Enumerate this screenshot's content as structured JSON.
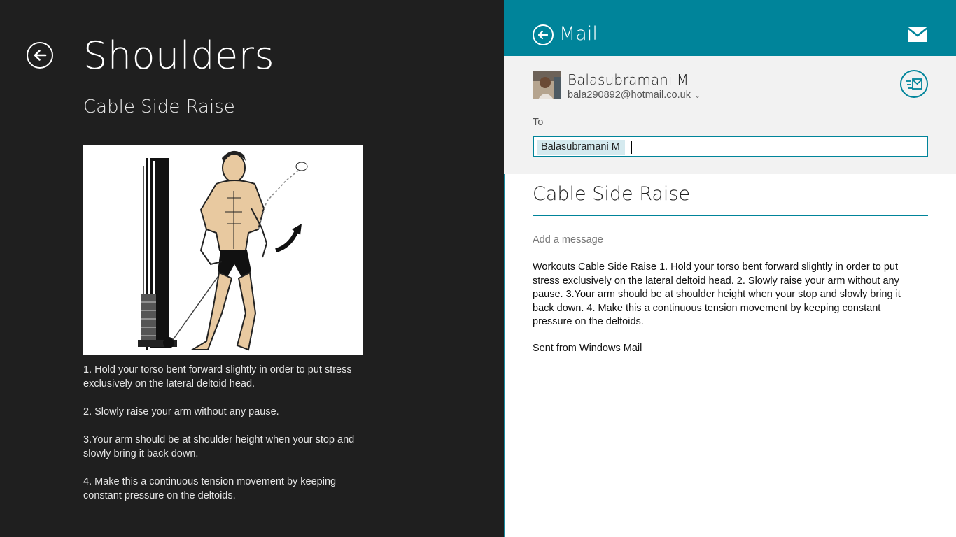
{
  "left_pane": {
    "title": "Shoulders",
    "exercise_name": "Cable Side Raise",
    "steps": [
      "1. Hold your torso bent forward slightly in order to put stress exclusively on the lateral deltoid head.",
      "2. Slowly raise your arm without any pause.",
      "3.Your arm should be at shoulder height when your stop and slowly bring it back down.",
      "4. Make this a continuous tension movement by keeping constant pressure on the deltoids."
    ]
  },
  "mail": {
    "title": "Mail",
    "from_name": "Balasubramani M",
    "from_email": "bala290892@hotmail.co.uk",
    "to_label": "To",
    "recipient": "Balasubramani M",
    "subject": "Cable Side Raise",
    "add_message_placeholder": "Add a message",
    "body": "Workouts Cable Side Raise 1. Hold your torso bent forward slightly in order to put stress exclusively on the lateral deltoid head. 2. Slowly raise your arm without any pause. 3.Your arm should be at shoulder height when your stop and slowly bring it back down. 4. Make this a continuous tension movement by keeping constant pressure on the deltoids.",
    "signature": "Sent from Windows Mail"
  },
  "colors": {
    "accent": "#00849a",
    "dark_bg": "#1f1f1f",
    "panel_gray": "#f2f2f2"
  },
  "icons": [
    "back-arrow-icon",
    "envelope-icon",
    "priority-icon",
    "chevron-down-icon"
  ]
}
